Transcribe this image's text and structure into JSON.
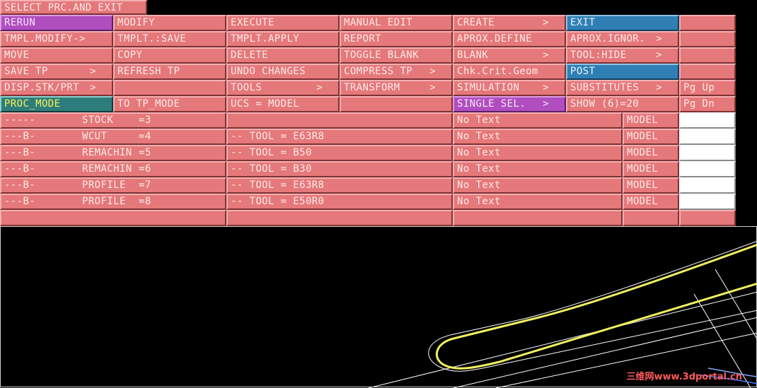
{
  "title": "SELECT PRC.AND EXIT",
  "menu": {
    "row1": [
      "RERUN",
      "MODIFY",
      "EXECUTE",
      "MANUAL EDIT",
      "CREATE",
      "EXIT",
      ""
    ],
    "row2": [
      "TMPL.MODIFY->",
      "TMPLT.:SAVE",
      "TMPLT.APPLY",
      "REPORT",
      "APROX.DEFINE",
      "APROX.IGNOR.",
      ""
    ],
    "row3": [
      "MOVE",
      "COPY",
      "DELETE",
      "TOGGLE BLANK",
      "BLANK",
      "TOOL:HIDE",
      ""
    ],
    "row4": [
      "SAVE TP",
      "REFRESH TP",
      "UNDO CHANGES",
      "COMPRESS TP",
      "Chk.Crit.Geom",
      "POST",
      ""
    ],
    "row5": [
      "DISP.STK/PRT",
      "",
      "TOOLS",
      "TRANSFORM",
      "SIMULATION",
      "SUBSTITUTES",
      "Pg Up"
    ],
    "row6": [
      "PROC_MODE",
      "TO TP_MODE",
      "UCS = MODEL",
      "",
      "SINGLE SEL.",
      "SHOW (6)=20",
      "Pg Dn"
    ],
    "arrows": {
      "submenu": ">"
    }
  },
  "procedures": [
    {
      "flags": "-----",
      "name": "STOCK",
      "num": "=3",
      "tool": "",
      "text": "No Text",
      "ucs": "MODEL"
    },
    {
      "flags": "---B-",
      "name": "WCUT",
      "num": "=4",
      "tool": "-- TOOL = E63R8",
      "text": "No Text",
      "ucs": "MODEL"
    },
    {
      "flags": "---B-",
      "name": "REMACHIN",
      "num": "=5",
      "tool": "-- TOOL = B50",
      "text": "No Text",
      "ucs": "MODEL"
    },
    {
      "flags": "---B-",
      "name": "REMACHIN",
      "num": "=6",
      "tool": "-- TOOL = B30",
      "text": "No Text",
      "ucs": "MODEL"
    },
    {
      "flags": "---B-",
      "name": "PROFILE",
      "num": "=7",
      "tool": "-- TOOL = E63R8",
      "text": "No Text",
      "ucs": "MODEL"
    },
    {
      "flags": "---B-",
      "name": "PROFILE",
      "num": "=8",
      "tool": "-- TOOL = E50R0",
      "text": "No Text",
      "ucs": "MODEL"
    }
  ],
  "watermark": "三维网www.3dportal.cn",
  "colors": {
    "menu": "#e5787a",
    "selected_purple": "#b04ec0",
    "selected_blue": "#2f7fb5",
    "mode_teal": "#2f7c7c",
    "mode_text": "#f5f55a",
    "toolpath": "#f0f060"
  }
}
